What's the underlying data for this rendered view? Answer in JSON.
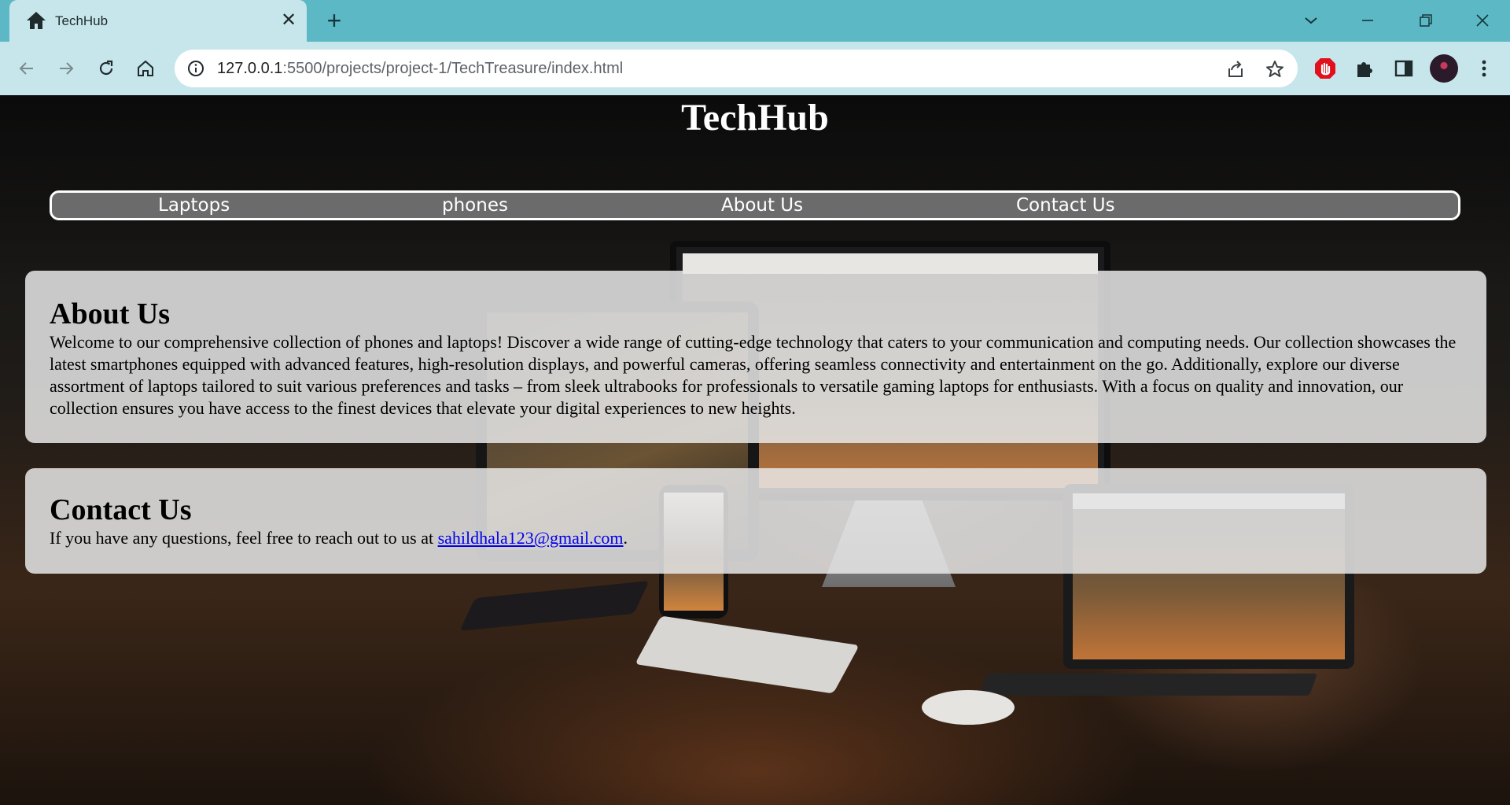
{
  "browser": {
    "tab_title": "TechHub",
    "tab_close_glyph": "✕",
    "new_tab_glyph": "+",
    "url_host": "127.0.0.1",
    "url_rest": ":5500/projects/project-1/TechTreasure/index.html",
    "icons": [
      "home-icon",
      "back-icon",
      "forward-icon",
      "reload-icon",
      "info-icon",
      "share-icon",
      "star-icon",
      "adblock-icon",
      "extensions-icon",
      "sidepanel-icon",
      "avatar",
      "menu-icon",
      "tab-search-icon",
      "minimize-icon",
      "restore-icon",
      "close-window-icon"
    ],
    "colors": {
      "tabbar": "#5bb8c4",
      "toolbar": "#c7e6eb",
      "adblock": "#e0101d"
    }
  },
  "page": {
    "title": "TechHub",
    "nav": [
      "Laptops",
      "phones",
      "About Us",
      "Contact Us"
    ],
    "about": {
      "heading": "About Us",
      "body": "Welcome to our comprehensive collection of phones and laptops! Discover a wide range of cutting-edge technology that caters to your communication and computing needs. Our collection showcases the latest smartphones equipped with advanced features, high-resolution displays, and powerful cameras, offering seamless connectivity and entertainment on the go. Additionally, explore our diverse assortment of laptops tailored to suit various preferences and tasks – from sleek ultrabooks for professionals to versatile gaming laptops for enthusiasts. With a focus on quality and innovation, our collection ensures you have access to the finest devices that elevate your digital experiences to new heights."
    },
    "contact": {
      "heading": "Contact Us",
      "text_before": "If you have any questions, feel free to reach out to us at ",
      "email": "sahildhala123@gmail.com",
      "text_after": "."
    },
    "colors": {
      "nav_bg": "#6b6b6b",
      "card_bg": "rgba(230,230,230,0.86)",
      "link": "#0000ee"
    }
  }
}
